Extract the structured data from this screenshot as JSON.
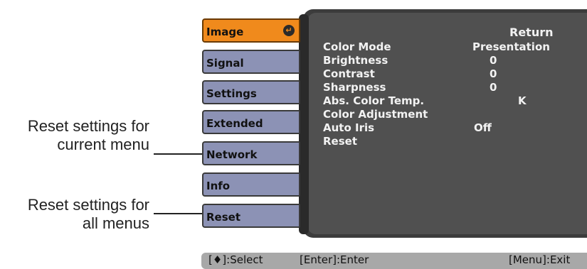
{
  "callouts": {
    "current_line1": "Reset settings for",
    "current_line2": "current menu",
    "all_line1": "Reset settings for",
    "all_line2": "all menus"
  },
  "tabs": [
    {
      "label": "Image",
      "active": true
    },
    {
      "label": "Signal",
      "active": false
    },
    {
      "label": "Settings",
      "active": false
    },
    {
      "label": "Extended",
      "active": false
    },
    {
      "label": "Network",
      "active": false
    },
    {
      "label": "Info",
      "active": false
    },
    {
      "label": "Reset",
      "active": false
    }
  ],
  "tab_enter_icon": "enter-icon",
  "menu": {
    "return_label": "Return",
    "rows": [
      {
        "label": "Color Mode",
        "value": "Presentation"
      },
      {
        "label": "Brightness",
        "value": "0"
      },
      {
        "label": "Contrast",
        "value": "0"
      },
      {
        "label": "Sharpness",
        "value": "0"
      },
      {
        "label": "Abs. Color Temp.",
        "value": "K"
      },
      {
        "label": "Color Adjustment",
        "value": ""
      },
      {
        "label": "Auto Iris",
        "value": "Off"
      },
      {
        "label": "Reset",
        "value": ""
      }
    ]
  },
  "statusbar": {
    "select": "[♦]:Select",
    "enter": "[Enter]:Enter",
    "exit": "[Menu]:Exit"
  },
  "colors": {
    "active_tab": "#f08a1c",
    "inactive_tab": "#8c92b5",
    "panel": "#505050",
    "text": "#f2f2f2",
    "statusbar": "#a8a8a8"
  }
}
